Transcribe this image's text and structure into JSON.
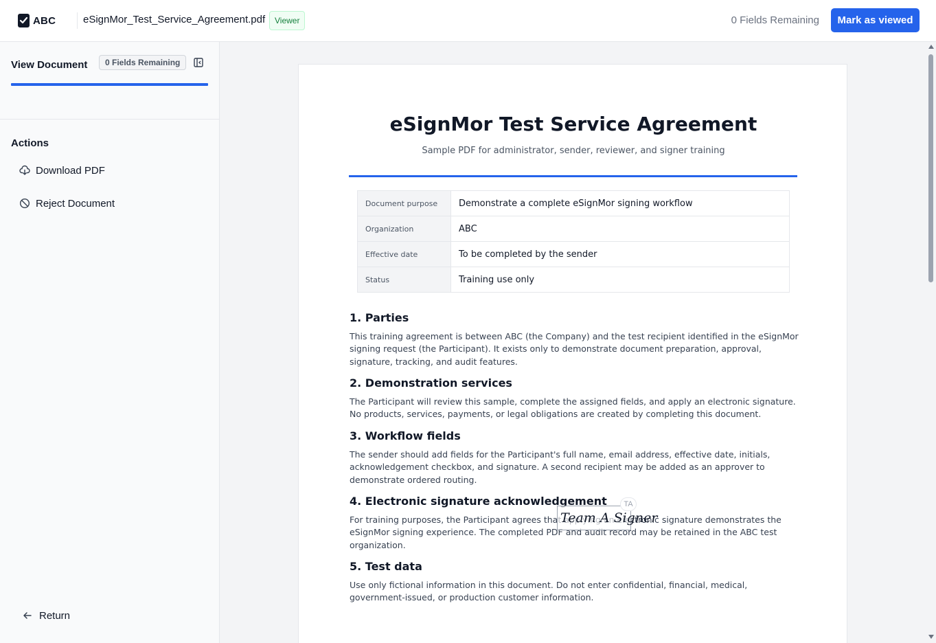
{
  "header": {
    "logo_text": "ABC",
    "document_name": "eSignMor_Test_Service_Agreement.pdf",
    "role_badge": "Viewer",
    "fields_remaining": "0 Fields Remaining",
    "mark_viewed_label": "Mark as viewed"
  },
  "sidebar": {
    "tab_title": "View Document",
    "tab_badge": "0 Fields Remaining",
    "actions_title": "Actions",
    "actions": [
      {
        "label": "Download PDF",
        "icon": "cloud-download-icon"
      },
      {
        "label": "Reject Document",
        "icon": "ban-icon"
      }
    ],
    "return_label": "Return"
  },
  "document": {
    "title": "eSignMor Test Service Agreement",
    "subtitle": "Sample PDF for administrator, sender, reviewer, and signer training",
    "info_rows": [
      {
        "key": "Document purpose",
        "value": "Demonstrate a complete eSignMor signing workflow"
      },
      {
        "key": "Organization",
        "value": "ABC"
      },
      {
        "key": "Effective date",
        "value": "To be completed by the sender"
      },
      {
        "key": "Status",
        "value": "Training use only"
      }
    ],
    "sections": [
      {
        "heading": "1. Parties",
        "body": "This training agreement is between ABC (the Company) and the test recipient identified in the eSignMor signing request (the Participant). It exists only to demonstrate document preparation, approval, signature, tracking, and audit features."
      },
      {
        "heading": "2. Demonstration services",
        "body": "The Participant will review this sample, complete the assigned fields, and apply an electronic signature. No products, services, payments, or legal obligations are created by completing this document."
      },
      {
        "heading": "3. Workflow fields",
        "body": "The sender should add fields for the Participant's full name, email address, effective date, initials, acknowledgement checkbox, and signature. A second recipient may be added as an approver to demonstrate ordered routing."
      },
      {
        "heading": "4. Electronic signature acknowledgement",
        "body": "For training purposes, the Participant agrees that applying an electronic signature demonstrates the eSignMor signing experience. The completed PDF and audit record may be retained in the ABC test organization."
      },
      {
        "heading": "5. Test data",
        "body": "Use only fictional information in this document. Do not enter confidential, financial, medical, government-issued, or production customer information."
      }
    ],
    "signature": {
      "text": "Team A Signer",
      "initials": "TA"
    }
  },
  "colors": {
    "accent": "#2563eb",
    "viewer_badge": "#15803d"
  }
}
